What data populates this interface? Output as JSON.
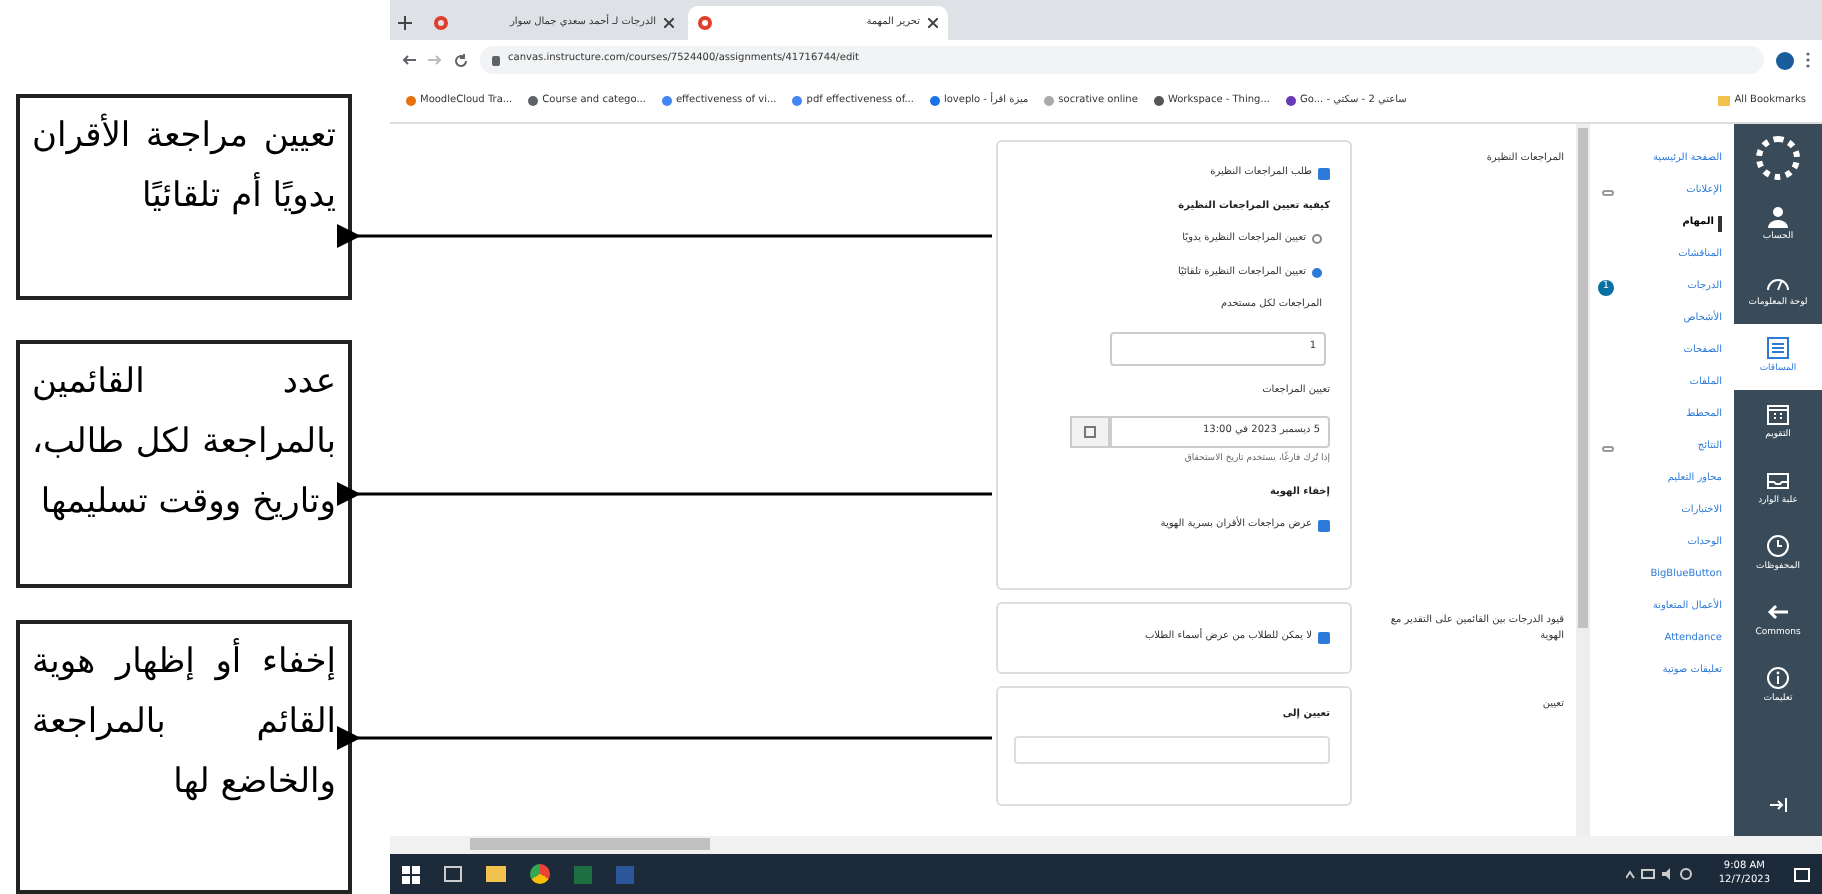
{
  "annotations": [
    {
      "text": "تعيين مراجعة الأقران يدويًا أم تلقائيًا"
    },
    {
      "text": "عدد القائمين بالمراجعة لكل طالب، وتاريخ ووقت تسليمها"
    },
    {
      "text": "إخفاء أو إظهار هوية القائم بالمراجعة والخاضع لها"
    }
  ],
  "browser": {
    "tabs": [
      {
        "title": "تحرير المهمة",
        "selected": true
      },
      {
        "title": "الدرجات لـ أحمد سعدي جمال سوار",
        "selected": false
      }
    ],
    "url": "canvas.instructure.com/courses/7524400/assignments/41716744/edit",
    "bookmarks": [
      "Go... - ساعتي 2 - سكتي",
      "Workspace - Thing...",
      "socrative online",
      "loveplo - ميزة اقرأ",
      "pdf effectiveness of...",
      "effectiveness of vi...",
      "Course and catego...",
      "MoodleCloud Tra..."
    ],
    "all_bookmarks": "All Bookmarks"
  },
  "form": {
    "peer_reviews": {
      "label": "المراجعات النظيرة",
      "require": {
        "label": "طلب المراجعات النظيرة",
        "checked": true
      },
      "method_heading": "كيفية تعيين المراجعات النظيرة",
      "methods": [
        {
          "label": "تعيين المراجعات النظيرة يدويًا",
          "selected": false
        },
        {
          "label": "تعيين المراجعات النظيرة تلقائيًا",
          "selected": true
        }
      ],
      "per_user_label": "المراجعات لكل مستخدم",
      "per_user_value": "1",
      "assign_label": "تعيين المراجعات",
      "assign_value": "5 ديسمبر 2023 في 13:00",
      "assign_hint": "إذا تُرك فارغًا، يستخدم تاريخ الاستحقاق",
      "anonymity_heading": "إخفاء الهوية",
      "anonymous": {
        "label": "عرض مراجعات الأقران بسرية الهوية",
        "checked": true
      }
    },
    "anonymous_grading": {
      "label": "قيود الدرجات بين القائمين على التقدير مع الهوية",
      "option": {
        "label": "لا يمكن للطلاب من عرض أسماء الطلاب",
        "checked": true
      }
    },
    "assign": {
      "label": "تعيين",
      "heading": "تعيين إلى"
    }
  },
  "course_nav": [
    {
      "label": "الصفحة الرئيسية",
      "selected": false
    },
    {
      "label": "الإعلانات",
      "selected": false,
      "hidden": true
    },
    {
      "label": "المهام",
      "selected": true
    },
    {
      "label": "المناقشات",
      "selected": false
    },
    {
      "label": "الدرجات",
      "selected": false,
      "badge": "1"
    },
    {
      "label": "الأشخاص",
      "selected": false
    },
    {
      "label": "الصفحات",
      "selected": false
    },
    {
      "label": "الملفات",
      "selected": false
    },
    {
      "label": "المخطط",
      "selected": false
    },
    {
      "label": "النتائج",
      "selected": false,
      "hidden": true
    },
    {
      "label": "محاور التعليم",
      "selected": false
    },
    {
      "label": "الاختبارات",
      "selected": false
    },
    {
      "label": "الوحدات",
      "selected": false
    },
    {
      "label": "BigBlueButton",
      "selected": false
    },
    {
      "label": "الأعمال المتعاونة",
      "selected": false
    },
    {
      "label": "Attendance",
      "selected": false
    },
    {
      "label": "تعليقات صوتية",
      "selected": false
    }
  ],
  "global_nav": [
    {
      "kind": "account",
      "label": "الحساب",
      "selected": false
    },
    {
      "kind": "dashboard",
      "label": "لوحة المعلومات",
      "selected": false
    },
    {
      "kind": "courses",
      "label": "المساقات",
      "selected": true
    },
    {
      "kind": "calendar",
      "label": "التقويم",
      "selected": false
    },
    {
      "kind": "inbox",
      "label": "علبة الوارد",
      "selected": false
    },
    {
      "kind": "history",
      "label": "المحفوظات",
      "selected": false
    },
    {
      "kind": "commons",
      "label": "Commons",
      "selected": false
    },
    {
      "kind": "help",
      "label": "تعليمات",
      "selected": false
    }
  ],
  "taskbar": {
    "time": "9:08 AM",
    "date": "12/7/2023"
  }
}
